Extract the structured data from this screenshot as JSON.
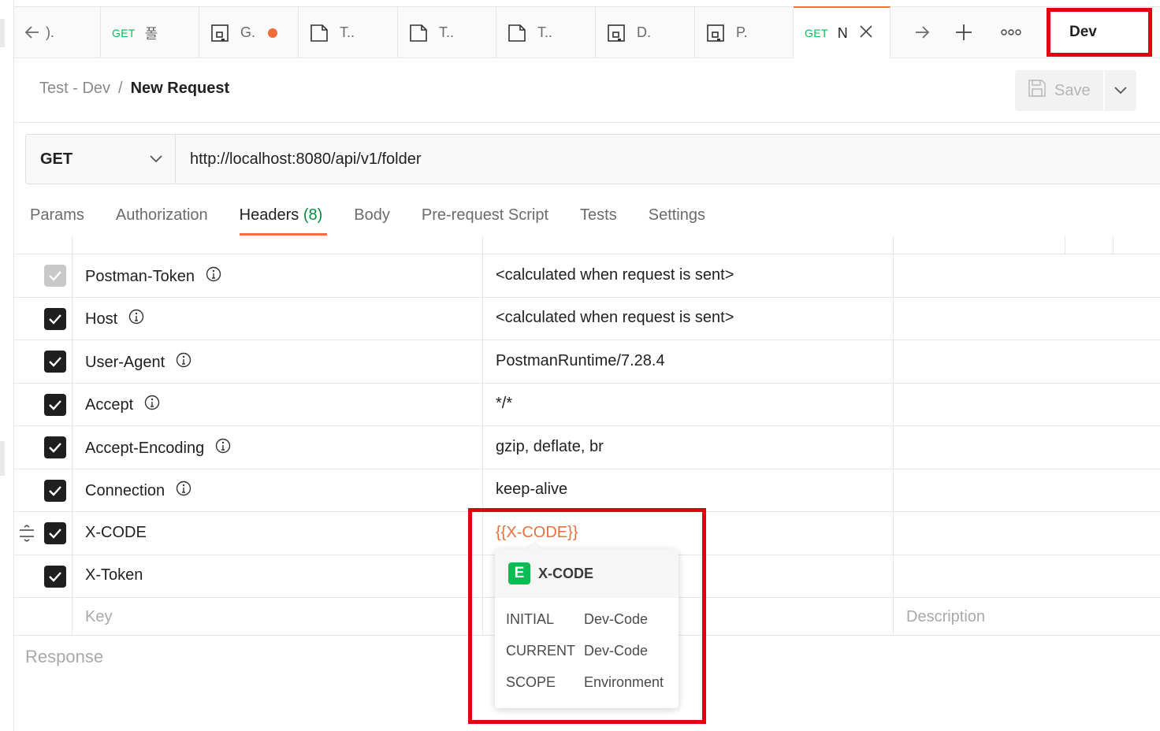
{
  "tabs": [
    {
      "method": "",
      "label": ")."
    },
    {
      "method": "GET",
      "label": "폴"
    },
    {
      "method": "",
      "label": "G."
    },
    {
      "method": "",
      "label": "T.."
    },
    {
      "method": "",
      "label": "T.."
    },
    {
      "method": "",
      "label": "T.."
    },
    {
      "method": "",
      "label": "D."
    },
    {
      "method": "",
      "label": "P."
    },
    {
      "method": "GET",
      "label": "N"
    }
  ],
  "environment": {
    "selected": "Dev"
  },
  "breadcrumb": {
    "parent": "Test - Dev",
    "separator": "/",
    "current": "New Request"
  },
  "save_label": "Save",
  "request": {
    "method": "GET",
    "url": "http://localhost:8080/api/v1/folder"
  },
  "request_tabs": {
    "params": "Params",
    "authorization": "Authorization",
    "headers": "Headers",
    "headers_count": "(8)",
    "body": "Body",
    "prerequest": "Pre-request Script",
    "tests": "Tests",
    "settings": "Settings"
  },
  "headers": [
    {
      "key": "Postman-Token",
      "value": "<calculated when request is sent>"
    },
    {
      "key": "Host",
      "value": "<calculated when request is sent>"
    },
    {
      "key": "User-Agent",
      "value": "PostmanRuntime/7.28.4"
    },
    {
      "key": "Accept",
      "value": "*/*"
    },
    {
      "key": "Accept-Encoding",
      "value": "gzip, deflate, br"
    },
    {
      "key": "Connection",
      "value": "keep-alive"
    },
    {
      "key": "X-CODE",
      "value": "{{X-CODE}}"
    },
    {
      "key": "X-Token",
      "value": ""
    }
  ],
  "new_row": {
    "key_placeholder": "Key",
    "description_placeholder": "Description"
  },
  "response_label": "Response",
  "variable_popover": {
    "badge": "E",
    "name": "X-CODE",
    "initial_label": "INITIAL",
    "initial_value": "Dev-Code",
    "current_label": "CURRENT",
    "current_value": "Dev-Code",
    "scope_label": "SCOPE",
    "scope_value": "Environment"
  },
  "colors": {
    "accent": "#ff6c37",
    "get_method": "#0cbb52",
    "highlight": "#e3000f",
    "variable": "#e5703f"
  }
}
